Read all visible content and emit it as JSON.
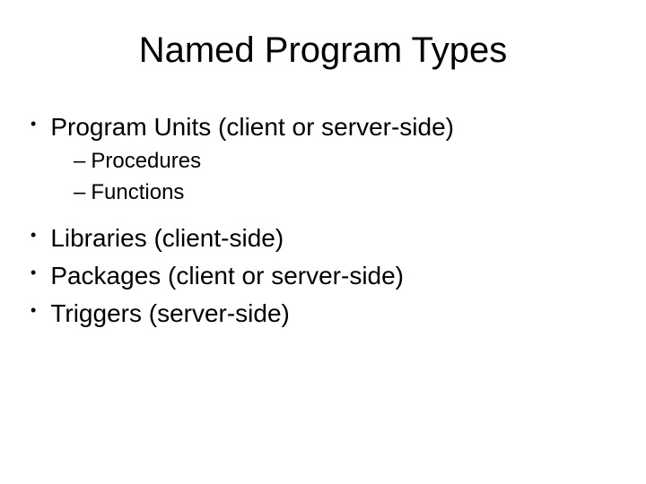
{
  "title": "Named Program Types",
  "bullets": {
    "l1_0": "Program Units (client or server-side)",
    "l2_0": "Procedures",
    "l2_1": "Functions",
    "l1_1": "Libraries (client-side)",
    "l1_2": "Packages (client or server-side)",
    "l1_3": "Triggers (server-side)"
  }
}
